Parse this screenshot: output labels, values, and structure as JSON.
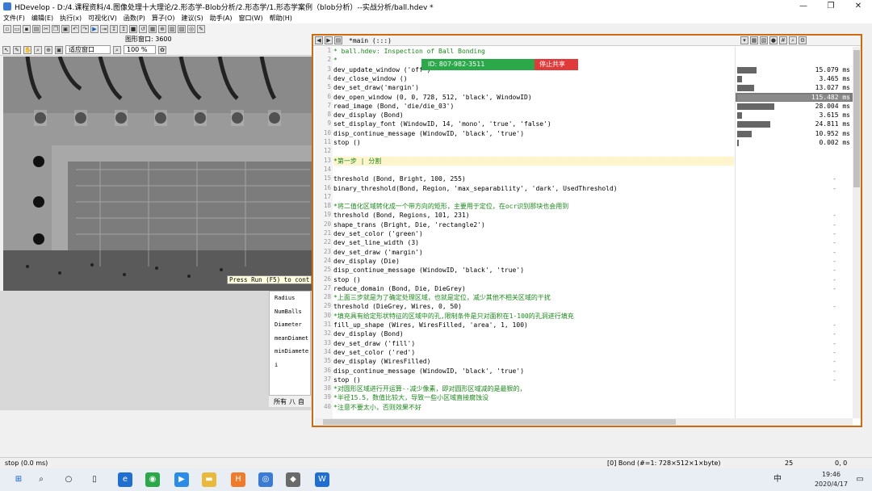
{
  "window": {
    "title": "HDevelop - D:/4.课程资料/4.图像处理十大理论/2.形态学-Blob分析/2.形态学/1.形态学案例（blob分析）--实战分析/ball.hdev *",
    "minimize": "—",
    "maximize": "❐",
    "close": "✕"
  },
  "menu": [
    "文件(F)",
    "编辑(E)",
    "执行(x)",
    "可视化(V)",
    "函数(P)",
    "算子(O)",
    "建议(S)",
    "助手(A)",
    "窗口(W)",
    "帮助(H)"
  ],
  "graphics": {
    "window_label": "图形窗口: 3600",
    "fit_mode": "适应窗口",
    "zoom": "100 %",
    "tooltip": "Press Run (F5) to cont"
  },
  "variables": {
    "names": [
      "Radius",
      "NumBalls",
      "Diameter",
      "meanDiamet",
      "minDiamete",
      "i"
    ],
    "tabs": [
      "所有",
      "八",
      "自"
    ]
  },
  "editor": {
    "tab": "*main (:::)",
    "lines": [
      {
        "n": "1",
        "text": "* ball.hdev: Inspection of Ball Bonding",
        "comment": true
      },
      {
        "n": "2",
        "text": "*",
        "comment": true
      },
      {
        "n": "3",
        "text": "dev_update_window ('off')",
        "comment": false
      },
      {
        "n": "4",
        "text": "dev_close_window ()",
        "comment": false
      },
      {
        "n": "5",
        "text": "dev_set_draw('margin')",
        "comment": false
      },
      {
        "n": "6",
        "text": "dev_open_window (0, 0, 728, 512, 'black', WindowID)",
        "comment": false
      },
      {
        "n": "7",
        "text": "read_image (Bond, 'die/die_03')",
        "comment": false
      },
      {
        "n": "8",
        "text": "dev_display (Bond)",
        "comment": false
      },
      {
        "n": "9",
        "text": "set_display_font (WindowID, 14, 'mono', 'true', 'false')",
        "comment": false
      },
      {
        "n": "10",
        "text": "disp_continue_message (WindowID, 'black', 'true')",
        "comment": false
      },
      {
        "n": "11",
        "text": "stop ()",
        "comment": false
      },
      {
        "n": "12",
        "text": "",
        "comment": false
      },
      {
        "n": "13",
        "text": "*第一步 | 分割",
        "comment": true
      },
      {
        "n": "14",
        "text": "",
        "comment": false
      },
      {
        "n": "15",
        "text": "threshold (Bond, Bright, 100, 255)",
        "comment": false
      },
      {
        "n": "16",
        "text": "binary_threshold(Bond, Region, 'max_separability', 'dark', UsedThreshold)",
        "comment": false
      },
      {
        "n": "17",
        "text": "",
        "comment": false
      },
      {
        "n": "18",
        "text": "*将二值化区域转化成一个带方向的矩形，主要用于定位，在ocr识别那块也会用到",
        "comment": true
      },
      {
        "n": "19",
        "text": "threshold (Bond, Regions, 101, 231)",
        "comment": false
      },
      {
        "n": "20",
        "text": "shape_trans (Bright, Die, 'rectangle2')",
        "comment": false
      },
      {
        "n": "21",
        "text": "dev_set_color ('green')",
        "comment": false
      },
      {
        "n": "22",
        "text": "dev_set_line_width (3)",
        "comment": false
      },
      {
        "n": "23",
        "text": "dev_set_draw ('margin')",
        "comment": false
      },
      {
        "n": "24",
        "text": "dev_display (Die)",
        "comment": false
      },
      {
        "n": "25",
        "text": "disp_continue_message (WindowID, 'black', 'true')",
        "comment": false
      },
      {
        "n": "26",
        "text": "stop ()",
        "comment": false
      },
      {
        "n": "27",
        "text": "reduce_domain (Bond, Die, DieGrey)",
        "comment": false
      },
      {
        "n": "28",
        "text": "*上面三步就是为了确定处理区域，也就是定位，减少其他不相关区域的干扰",
        "comment": true
      },
      {
        "n": "29",
        "text": "threshold (DieGrey, Wires, 0, 50)",
        "comment": false
      },
      {
        "n": "30",
        "text": "*填充具有给定形状特征的区域中的孔,限制条件是只对面积在1-100的孔洞进行填充",
        "comment": true
      },
      {
        "n": "31",
        "text": "fill_up_shape (Wires, WiresFilled, 'area', 1, 100)",
        "comment": false
      },
      {
        "n": "32",
        "text": "dev_display (Bond)",
        "comment": false
      },
      {
        "n": "33",
        "text": "dev_set_draw ('fill')",
        "comment": false
      },
      {
        "n": "34",
        "text": "dev_set_color ('red')",
        "comment": false
      },
      {
        "n": "35",
        "text": "dev_display (WiresFilled)",
        "comment": false
      },
      {
        "n": "36",
        "text": "disp_continue_message (WindowID, 'black', 'true')",
        "comment": false
      },
      {
        "n": "37",
        "text": "stop ()",
        "comment": false
      },
      {
        "n": "38",
        "text": "*对圆形区域进行开运算--减少像素，即对圆形区域减的是最狠的，",
        "comment": true
      },
      {
        "n": "39",
        "text": "*半径15.5，数值比较大，导致一些小区域直接腐蚀没",
        "comment": true
      },
      {
        "n": "40",
        "text": "*注意不要太小，否则效果不好",
        "comment": true
      }
    ],
    "times": [
      {
        "row": 3,
        "ms": "15.079 ms",
        "fraction": 0.17,
        "selected": false
      },
      {
        "row": 4,
        "ms": "3.465 ms",
        "fraction": 0.04,
        "selected": false
      },
      {
        "row": 5,
        "ms": "13.027 ms",
        "fraction": 0.15,
        "selected": false
      },
      {
        "row": 6,
        "ms": "115.482 ms",
        "fraction": 1.0,
        "selected": true
      },
      {
        "row": 7,
        "ms": "28.004 ms",
        "fraction": 0.33,
        "selected": false
      },
      {
        "row": 8,
        "ms": "3.615 ms",
        "fraction": 0.04,
        "selected": false
      },
      {
        "row": 9,
        "ms": "24.811 ms",
        "fraction": 0.29,
        "selected": false
      },
      {
        "row": 10,
        "ms": "10.952 ms",
        "fraction": 0.13,
        "selected": false
      },
      {
        "row": 11,
        "ms": "0.002 ms",
        "fraction": 0.0,
        "selected": false
      }
    ],
    "dash_rows": [
      15,
      16,
      19,
      20,
      21,
      22,
      23,
      24,
      25,
      26,
      27,
      29,
      31,
      32,
      33,
      34,
      35,
      36,
      37
    ],
    "dash": "-"
  },
  "share_banner": {
    "id": "ID: 807-982-3511",
    "stop": "停止共享"
  },
  "status": {
    "left": "stop (0.0 ms)",
    "image_info": "[0] Bond (#=1: 728×512×1×byte)",
    "zoom_value": "25",
    "coords": "0, 0"
  },
  "taskbar": {
    "time": "19:46",
    "date": "2020/4/17",
    "ime": "中"
  }
}
